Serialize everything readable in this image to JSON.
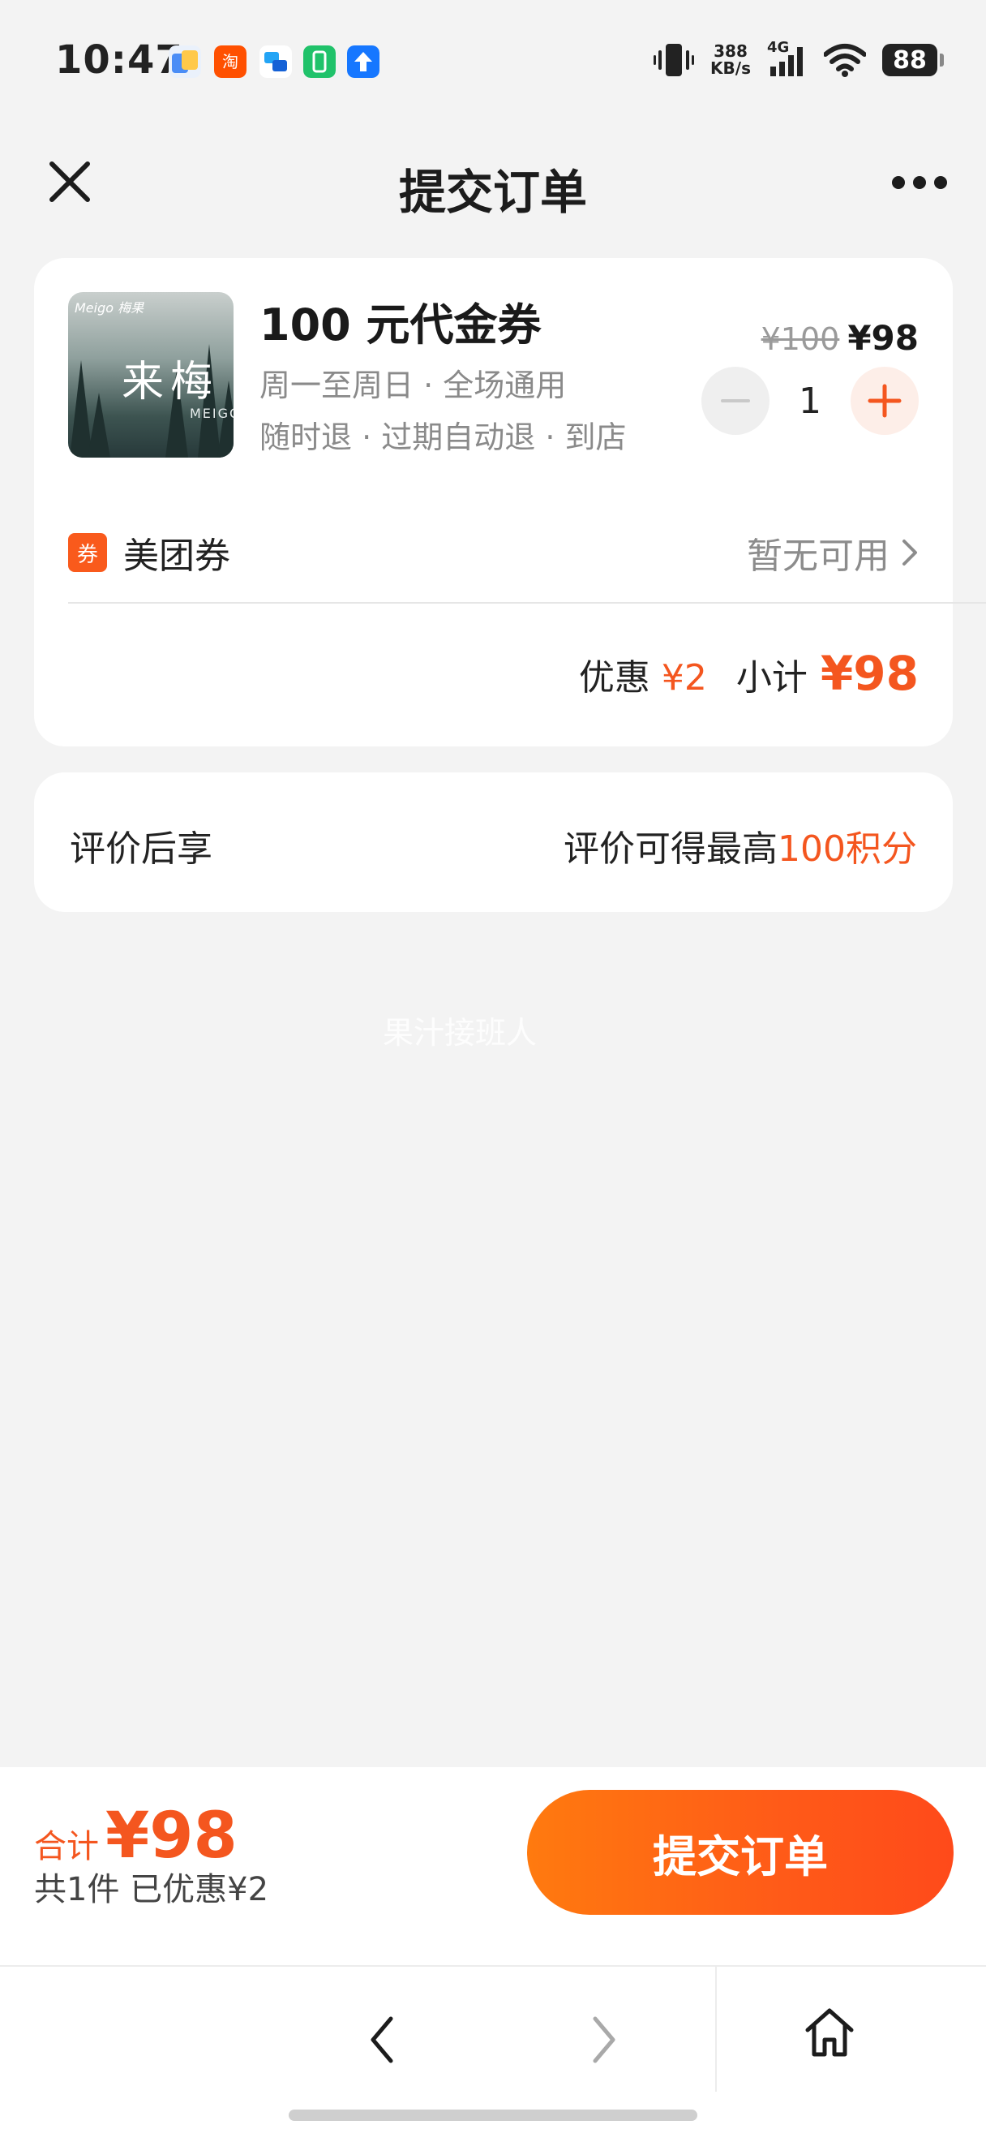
{
  "status_bar": {
    "time": "10:47",
    "net_speed_value": "388",
    "net_speed_unit": "KB/s",
    "network_type": "4G",
    "battery": "88"
  },
  "nav": {
    "title": "提交订单"
  },
  "product": {
    "thumb_brand": "Meigo 梅果",
    "thumb_text": "来梅",
    "thumb_sub": "MEIGO",
    "title": "100 元代金券",
    "subtitle_1": "周一至周日 · 全场通用",
    "subtitle_2": "随时退 · 过期自动退 · 到店",
    "original_price": "¥100",
    "price": "¥98",
    "quantity": "1"
  },
  "coupon": {
    "tag": "券",
    "label": "美团券",
    "status": "暂无可用"
  },
  "summary": {
    "discount_label": "优惠",
    "discount_value": "¥2",
    "subtotal_label": "小计",
    "subtotal_value": "¥98"
  },
  "review": {
    "label": "评价后享",
    "text": "评价可得最高",
    "highlight": "100积分"
  },
  "watermark": "果汁接班人",
  "bottom": {
    "total_label": "合计",
    "total_value": "¥98",
    "total_sub": "共1件  已优惠¥2",
    "submit_label": "提交订单"
  },
  "colors": {
    "accent": "#f4561f",
    "button_gradient_start": "#ff7a0f",
    "button_gradient_end": "#ff4a1a"
  }
}
